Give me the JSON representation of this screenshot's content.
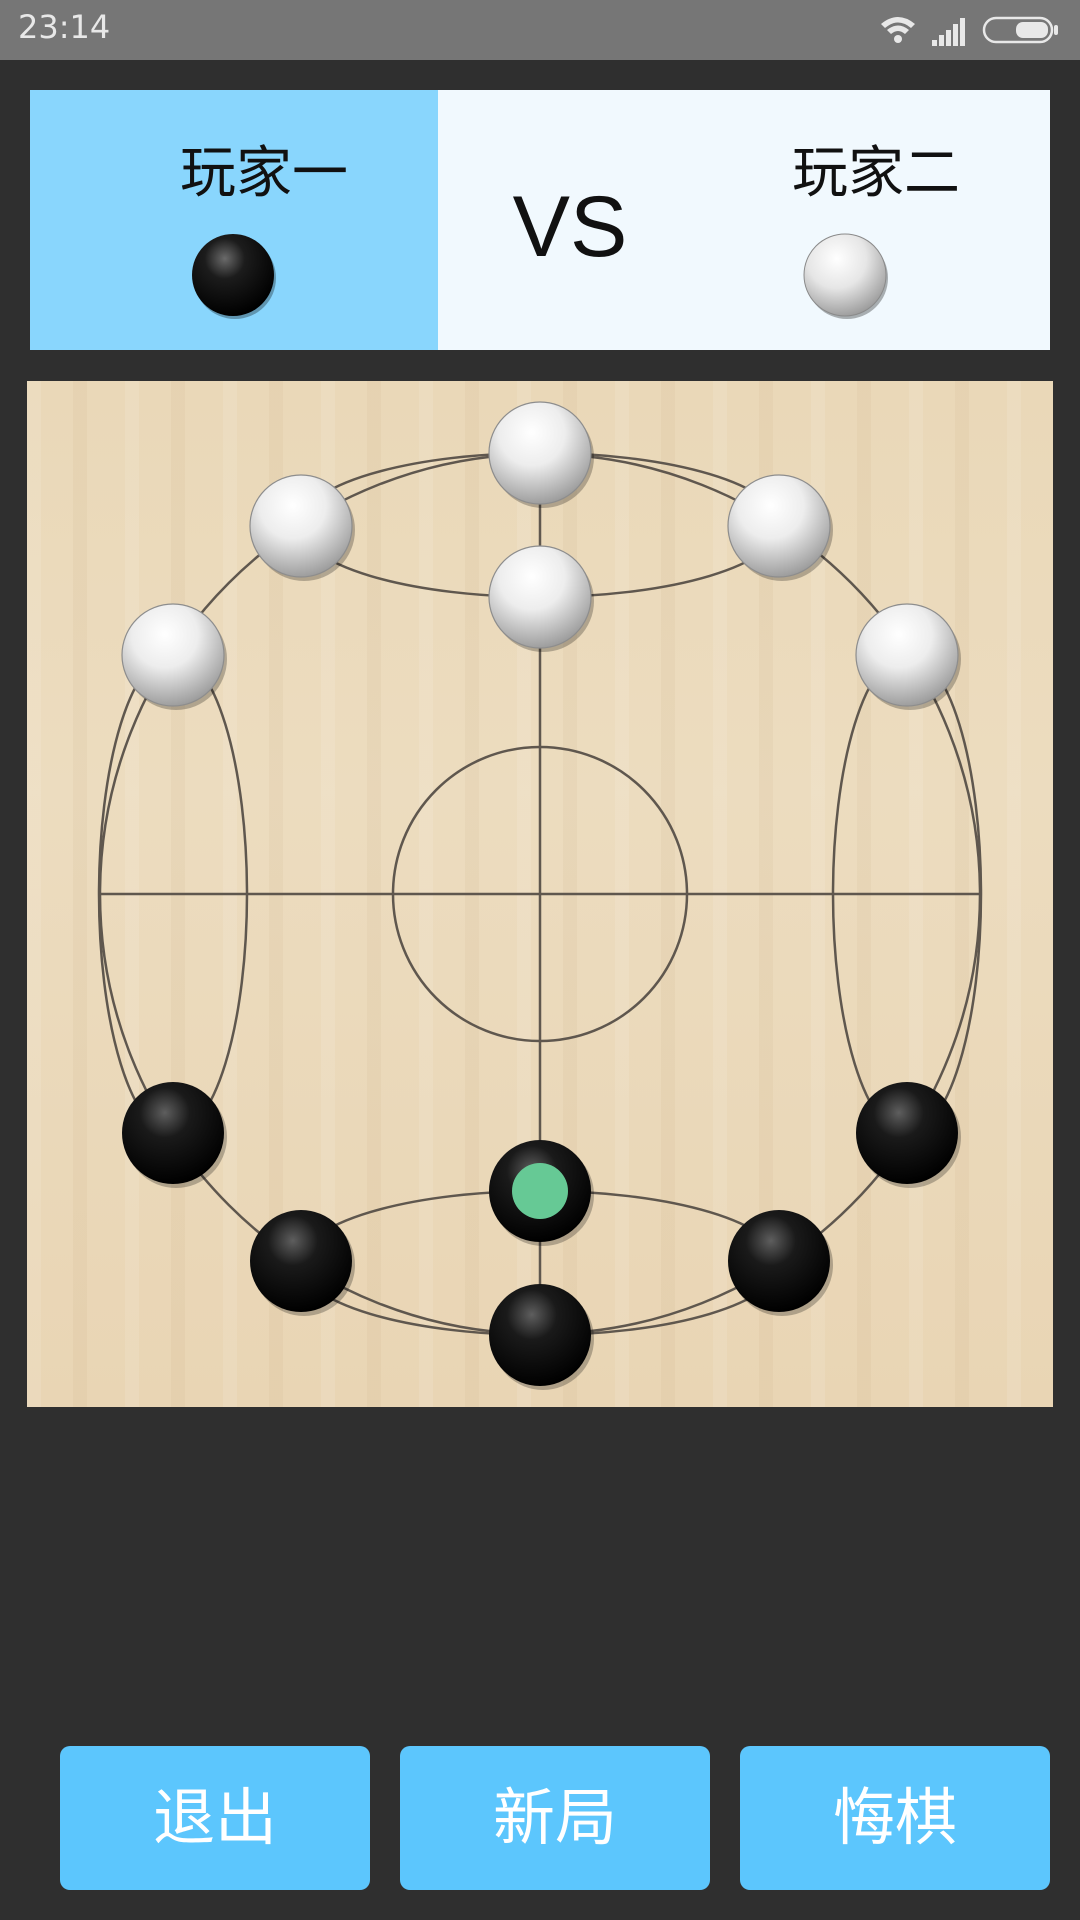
{
  "status": {
    "time": "23:14"
  },
  "players": {
    "p1": {
      "name": "玩家一",
      "stone": "black"
    },
    "vs": "VS",
    "p2": {
      "name": "玩家二",
      "stone": "white"
    }
  },
  "board": {
    "white_stones": [
      "top-outer",
      "top-inner",
      "upper-left",
      "upper-right",
      "left-top",
      "right-top"
    ],
    "black_stones": [
      "bottom-outer",
      "bottom-inner-selected",
      "lower-left",
      "lower-right",
      "left-bottom",
      "right-bottom"
    ],
    "selected_stone": "bottom-inner",
    "selected_marker_color": "#66c995"
  },
  "buttons": {
    "exit": "退出",
    "new_game": "新局",
    "undo": "悔棋"
  },
  "colors": {
    "accent": "#5cc6fd",
    "active_player": "#89d6fd",
    "inactive_player": "#f1f9fe",
    "background": "#2f2f2f"
  }
}
